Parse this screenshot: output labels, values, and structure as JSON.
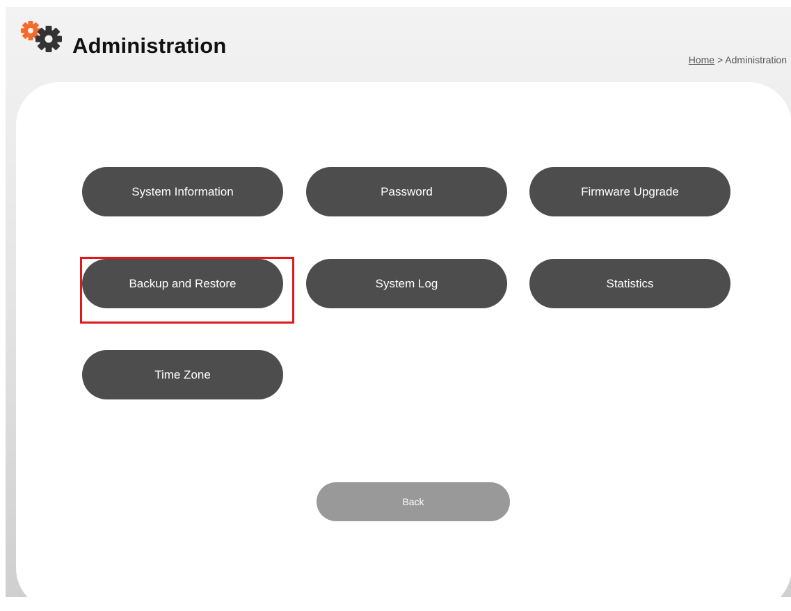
{
  "header": {
    "title": "Administration",
    "icon": "gears-icon",
    "gear_colors": {
      "small": "#f26b2a",
      "large": "#333333"
    }
  },
  "breadcrumb": {
    "home": "Home",
    "separator": ">",
    "current": "Administration"
  },
  "menu": {
    "items": [
      {
        "label": "System Information"
      },
      {
        "label": "Password"
      },
      {
        "label": "Firmware Upgrade"
      },
      {
        "label": "Backup and Restore",
        "highlighted": true
      },
      {
        "label": "System Log"
      },
      {
        "label": "Statistics"
      },
      {
        "label": "Time Zone"
      }
    ]
  },
  "back": {
    "label": "Back"
  },
  "colors": {
    "button": "#4d4d4d",
    "back_button": "#999999",
    "highlight": "#e0181b"
  }
}
